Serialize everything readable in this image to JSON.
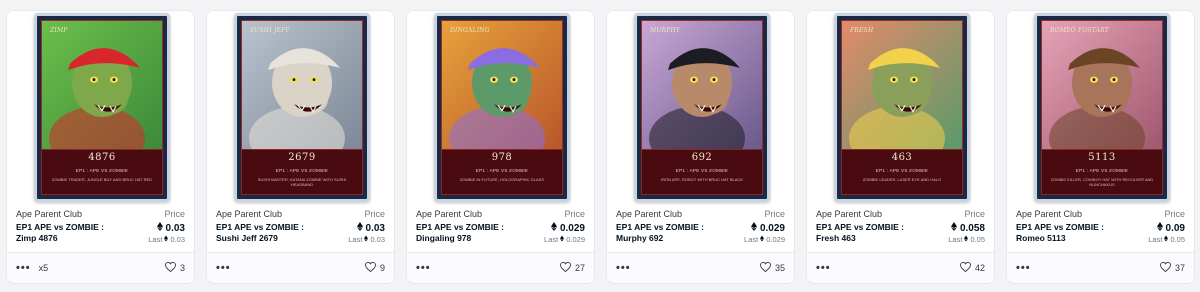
{
  "cards": [
    {
      "card_label": "Zimp",
      "number": "4876",
      "set_line": "EP1 : APE VS ZOMBIE",
      "desc": "ZOMBIE TRADER, JUNGLE BUY AND BRUC HAT RED",
      "collection": "Ape Parent Club",
      "price_label": "Price",
      "name": "EP1 APE vs ZOMBIE : Zimp 4876",
      "price": "0.03",
      "last_label": "Last",
      "last": "0.03",
      "quantity": "x5",
      "likes": "3",
      "palette": {
        "bg1": "#6bbf4a",
        "bg2": "#3d8a3a",
        "skin": "#7fa84a",
        "accent": "#d9262b"
      }
    },
    {
      "card_label": "Sushi Jeff",
      "number": "2679",
      "set_line": "EP1 : APE VS ZOMBIE",
      "desc": "SUSHI MASTER, KATANA ZOMBIE WITH SUSHI HEADBAND",
      "collection": "Ape Parent Club",
      "price_label": "Price",
      "name": "EP1 APE vs ZOMBIE : Sushi Jeff 2679",
      "price": "0.03",
      "last_label": "Last",
      "last": "0.03",
      "quantity": "",
      "likes": "9",
      "palette": {
        "bg1": "#b9c3cf",
        "bg2": "#7d8896",
        "skin": "#d9d3c8",
        "accent": "#e7e2da"
      }
    },
    {
      "card_label": "Dingaling",
      "number": "978",
      "set_line": "EP1 : APE VS ZOMBIE",
      "desc": "ZOMBIE IN FUTURE, HOLOGRAPHIC GLASS",
      "collection": "Ape Parent Club",
      "price_label": "Price",
      "name": "EP1 APE vs ZOMBIE : Dingaling 978",
      "price": "0.029",
      "last_label": "Last",
      "last": "0.029",
      "quantity": "",
      "likes": "27",
      "palette": {
        "bg1": "#e7a23a",
        "bg2": "#b8572a",
        "skin": "#5d9a6a",
        "accent": "#8a6de0"
      }
    },
    {
      "card_label": "Murphy",
      "number": "692",
      "set_line": "EP1 : APE VS ZOMBIE",
      "desc": "IRON APE, ROBOT WITH BRUC HAT BLACK",
      "collection": "Ape Parent Club",
      "price_label": "Price",
      "name": "EP1 APE vs ZOMBIE : Murphy 692",
      "price": "0.029",
      "last_label": "Last",
      "last": "0.029",
      "quantity": "",
      "likes": "35",
      "palette": {
        "bg1": "#c9a7d6",
        "bg2": "#6a5a8a",
        "skin": "#b98a6a",
        "accent": "#1c1c24"
      }
    },
    {
      "card_label": "Fresh",
      "number": "463",
      "set_line": "EP1 : APE VS ZOMBIE",
      "desc": "ZOMBIE LEADER, LASER EYE AND HALO",
      "collection": "Ape Parent Club",
      "price_label": "Price",
      "name": "EP1 APE vs ZOMBIE : Fresh 463",
      "price": "0.058",
      "last_label": "Last",
      "last": "0.05",
      "quantity": "",
      "likes": "42",
      "palette": {
        "bg1": "#e48a6a",
        "bg2": "#5a9a6a",
        "skin": "#8aa05a",
        "accent": "#f2d24a"
      }
    },
    {
      "card_label": "Romeo Fostart",
      "number": "5113",
      "set_line": "EP1 : APE VS ZOMBIE",
      "desc": "ZOMBIE KILLER, COWBOY HAT WITH REVOLVER AND NUNCHAKUS",
      "collection": "Ape Parent Club",
      "price_label": "Price",
      "name": "EP1 APE vs ZOMBIE : Romeo 5113",
      "price": "0.09",
      "last_label": "Last",
      "last": "0.05",
      "quantity": "",
      "likes": "37",
      "palette": {
        "bg1": "#e6a3b8",
        "bg2": "#a0586e",
        "skin": "#a8745a",
        "accent": "#6b4426"
      }
    }
  ],
  "icons": {
    "eth": "ethereum-icon",
    "more": "more-dots-icon",
    "like": "heart-icon"
  }
}
